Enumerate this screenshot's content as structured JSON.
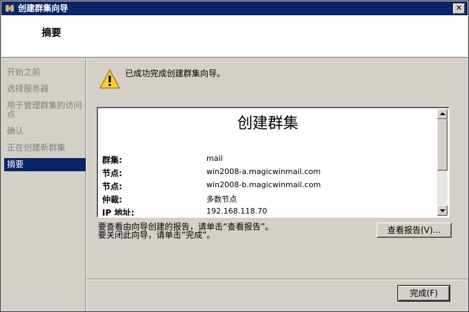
{
  "window": {
    "title": "创建群集向导",
    "close_glyph": "✕"
  },
  "header": {
    "title": "摘要"
  },
  "sidebar": {
    "steps": [
      {
        "label": "开始之前",
        "active": false
      },
      {
        "label": "选择服务器",
        "active": false
      },
      {
        "label": "用于管理群集的访问点",
        "active": false
      },
      {
        "label": "确认",
        "active": false
      },
      {
        "label": "正在创建新群集",
        "active": false
      },
      {
        "label": "摘要",
        "active": true
      }
    ]
  },
  "content": {
    "status_icon": "warning-icon",
    "success_message": "已成功完成创建群集向导。",
    "report": {
      "heading": "创建群集",
      "rows": [
        {
          "label": "群集:",
          "value": "mail"
        },
        {
          "label": "节点:",
          "value": "win2008-a.magicwinmail.com"
        },
        {
          "label": "节点:",
          "value": "win2008-b.magicwinmail.com"
        },
        {
          "label": "仲裁:",
          "value": "多数节点"
        },
        {
          "label": "IP 地址:",
          "value": "192.168.118.70"
        }
      ]
    },
    "hint_report": "要查看由向导创建的报告，请单击“查看报告”。",
    "hint_close": "要关闭此向导，请单击“完成”。",
    "view_report_label": "查看报告(V)...",
    "finish_label": "完成(F)"
  },
  "colors": {
    "titlebar": "#0a246a",
    "active_step": "#0a246a",
    "disabled_text": "#808080",
    "window_bg": "#d4d0c8"
  }
}
